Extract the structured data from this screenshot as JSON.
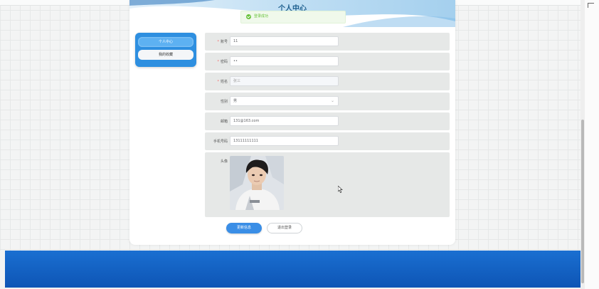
{
  "page": {
    "title": "个人中心",
    "toast": "登录成功"
  },
  "sidebar": {
    "items": [
      {
        "label": "个人中心",
        "active": true
      },
      {
        "label": "我的收藏",
        "active": false
      }
    ]
  },
  "form": {
    "account": {
      "label": "账号",
      "required": "*",
      "value": "11"
    },
    "password": {
      "label": "密码",
      "required": "*",
      "value": "••"
    },
    "name": {
      "label": "姓名",
      "required": "*",
      "value": "张三"
    },
    "gender": {
      "label": "性别",
      "value": "男"
    },
    "email": {
      "label": "邮箱",
      "value": "131@163.com"
    },
    "phone": {
      "label": "手机号码",
      "value": "13111111111"
    },
    "avatar": {
      "label": "头像"
    }
  },
  "buttons": {
    "update": "更新信息",
    "logout": "退出登录"
  },
  "colors": {
    "primary": "#3a8ee6",
    "footer": "#1466c8",
    "success": "#67c23a"
  }
}
